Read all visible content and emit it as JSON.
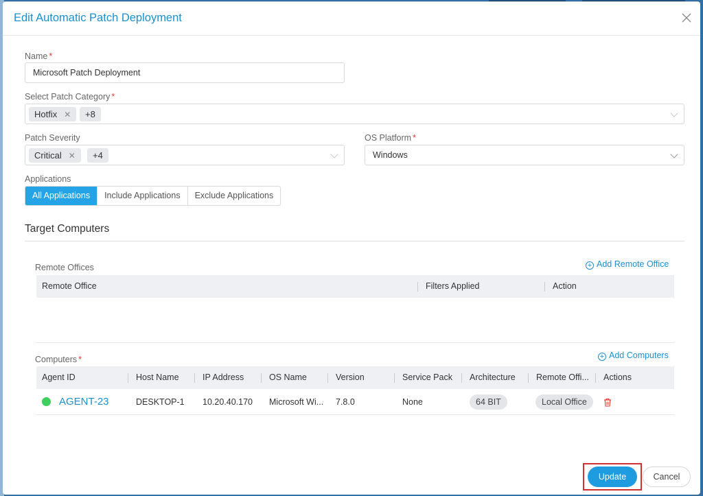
{
  "dialog": {
    "title": "Edit Automatic Patch Deployment",
    "close_icon": "close-icon"
  },
  "form": {
    "name": {
      "label": "Name",
      "value": "Microsoft Patch Deployment"
    },
    "patch_category": {
      "label": "Select Patch Category",
      "tags": [
        "Hotfix"
      ],
      "more": "+8"
    },
    "patch_severity": {
      "label": "Patch Severity",
      "tags": [
        "Critical"
      ],
      "more": "+4"
    },
    "os_platform": {
      "label": "OS Platform",
      "value": "Windows"
    },
    "applications": {
      "label": "Applications",
      "options": [
        "All Applications",
        "Include Applications",
        "Exclude Applications"
      ],
      "selected": "All Applications"
    }
  },
  "target": {
    "title": "Target Computers",
    "remote_offices": {
      "label": "Remote Offices",
      "add_link": "Add Remote Office",
      "columns": [
        "Remote Office",
        "Filters Applied",
        "Action"
      ],
      "rows": []
    },
    "computers": {
      "label": "Computers",
      "add_link": "Add Computers",
      "columns": [
        "Agent ID",
        "Host Name",
        "IP Address",
        "OS Name",
        "Version",
        "Service Pack",
        "Architecture",
        "Remote Offi...",
        "Actions"
      ],
      "rows": [
        {
          "agent_id": "AGENT-23",
          "status_color": "#3ecf5c",
          "host_name": "DESKTOP-1",
          "ip_address": "10.20.40.170",
          "os_name": "Microsoft Wi...",
          "version": "7.8.0",
          "service_pack": "None",
          "architecture": "64 BIT",
          "remote_office": "Local Office"
        }
      ]
    }
  },
  "footer": {
    "update": "Update",
    "cancel": "Cancel"
  },
  "colors": {
    "accent": "#1b8fd0",
    "primary_button": "#1f9be0",
    "required": "#e53935",
    "online": "#3ecf5c"
  }
}
